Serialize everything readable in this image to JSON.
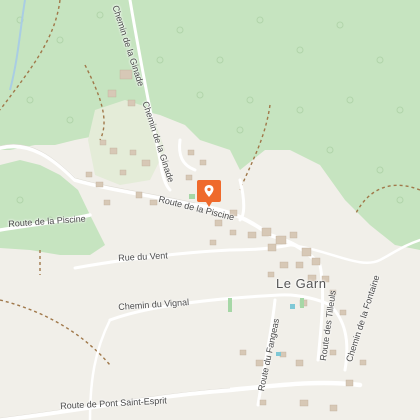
{
  "map": {
    "accent_color": "#ef6a2c",
    "forest_color": "#c6e4c0",
    "land_color": "#f1efe9",
    "marker": {
      "icon": "map-pin-icon"
    },
    "labels": {
      "town": "Le Garn",
      "route_piscine_upper": "Route de la Piscine",
      "route_piscine_left": "Route de la Piscine",
      "rue_vent": "Rue du Vent",
      "chemin_vignal": "Chemin du Vignal",
      "route_pont": "Route de Pont Saint-Esprit",
      "chemin_ginade_top": "Chemin de la Ginade",
      "chemin_ginade": "Chemin de la Ginade",
      "route_fangeas": "Route du Fangeas",
      "route_tilleuls": "Route des Tilleuls",
      "chemin_fontaine": "Chemin de la Fontaine"
    }
  }
}
